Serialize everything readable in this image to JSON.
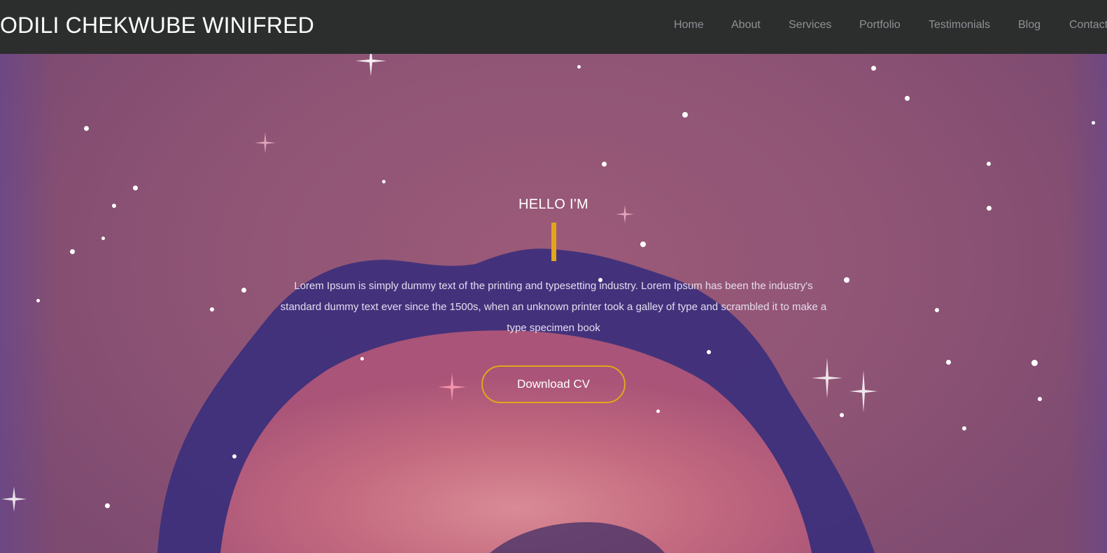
{
  "brand": {
    "name": "ODILI CHEKWUBE WINIFRED"
  },
  "nav": {
    "items": [
      {
        "label": "Home"
      },
      {
        "label": "About"
      },
      {
        "label": "Services"
      },
      {
        "label": "Portfolio"
      },
      {
        "label": "Testimonials"
      },
      {
        "label": "Blog"
      },
      {
        "label": "Contact"
      }
    ]
  },
  "hero": {
    "greeting": "HELLO I'M",
    "intro": "Lorem Ipsum is simply dummy text of the printing and typesetting industry. Lorem Ipsum has been the industry's standard dummy text ever since the 1500s, when an unknown printer took a galley of type and scrambled it to make a type specimen book",
    "cta_label": "Download CV"
  },
  "colors": {
    "navbar_bg": "#2c2e2d",
    "accent": "#e3a51c",
    "nav_text": "#8e9196"
  }
}
